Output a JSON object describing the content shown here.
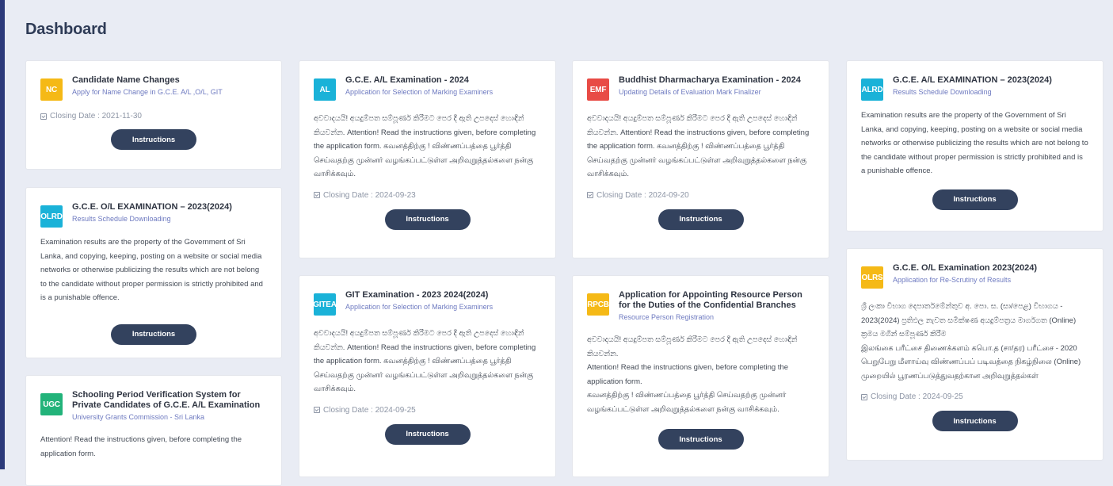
{
  "page": {
    "title": "Dashboard"
  },
  "button_label": "Instructions",
  "cards": {
    "nc": {
      "badge": "NC",
      "badge_color": "#f5b916",
      "title": "Candidate Name Changes",
      "subtitle": "Apply for Name Change in G.C.E. A/L ,O/L, GIT",
      "closing": "Closing Date : 2021-11-30"
    },
    "olrd": {
      "badge": "OLRD",
      "badge_color": "#1ab2d8",
      "title": "G.C.E. O/L EXAMINATION – 2023(2024)",
      "subtitle": "Results Schedule Downloading",
      "body": "Examination results are the property of the Government of Sri Lanka, and copying, keeping, posting on a website or social media networks or otherwise publicizing the results which are not belong to the candidate without proper permission is strictly prohibited and is a punishable offence."
    },
    "ugc": {
      "badge": "UGC",
      "badge_color": "#22b37a",
      "title": "Schooling Period Verification System for Private Candidates of G.C.E. A/L Examination",
      "subtitle": "University Grants Commission - Sri Lanka",
      "body": "Attention! Read the instructions given, before completing the application form."
    },
    "al": {
      "badge": "AL",
      "badge_color": "#1ab2d8",
      "title": "G.C.E. A/L Examination - 2024",
      "subtitle": "Application for Selection of Marking Examiners",
      "body": "අවවාදයයි! අයදුම්පත සම්පූර්ණ කිරීමට පෙර දී ඇති උපදෙස් හොඳින් කියවන්න. Attention! Read the instructions given, before completing the application form. கவனத்திற்கு ! விண்ணப்பத்தை பூர்த்தி செய்வதற்கு முன்னர் வழங்கப்பட்டுள்ள அறிவுறுத்தல்களை நன்கு வாசிக்கவும்.",
      "closing": "Closing Date : 2024-09-23"
    },
    "gitea": {
      "badge": "GITEA",
      "badge_color": "#1ab2d8",
      "title": "GIT Examination - 2023 2024(2024)",
      "subtitle": "Application for Selection of Marking Examiners",
      "body": "අවවාදයයි! අයදුම්පත සම්පූර්ණ කිරීමට පෙර දී ඇති උපදෙස් හොඳින් කියවන්න. Attention! Read the instructions given, before completing the application form. கவனத்திற்கு ! விண்ணப்பத்தை பூர்த்தி செய்வதற்கு முன்னர் வழங்கப்பட்டுள்ள அறிவுறுத்தல்களை நன்கு வாசிக்கவும்.",
      "closing": "Closing Date : 2024-09-25"
    },
    "emf": {
      "badge": "EMF",
      "badge_color": "#e84b45",
      "title": "Buddhist Dharmacharya Examination - 2024",
      "subtitle": "Updating Details of Evaluation Mark Finalizer",
      "body": "අවවාදයයි! අයදුම්පත සම්පූර්ණ කිරීමට පෙර දී ඇති උපදෙස් හොඳින් කියවන්න. Attention! Read the instructions given, before completing the application form. கவனத்திற்கு ! விண்ணப்பத்தை பூர்த்தி செய்வதற்கு முன்னர் வழங்கப்பட்டுள்ள அறிவுறுத்தல்களை நன்கு வாசிக்கவும்.",
      "closing": "Closing Date : 2024-09-20"
    },
    "rpcb": {
      "badge": "RPCB",
      "badge_color": "#f5b916",
      "title": "Application for Appointing Resource Person for the Duties of the Confidential Branches",
      "subtitle": "Resource Person Registration",
      "body_si": "අවවාදයයි! අයදුම්පත සම්පූර්ණ කිරීමට පෙර දී ඇති උපදෙස් හොඳින් කියවන්න.",
      "body_en": "Attention! Read the instructions given, before completing the application form.",
      "body_ta": "கவனத்திற்கு ! விண்ணப்பத்தை பூர்த்தி செய்வதற்கு முன்னர் வழங்கப்பட்டுள்ள அறிவுறுத்தல்களை நன்கு வாசிக்கவும்."
    },
    "alrd": {
      "badge": "ALRD",
      "badge_color": "#1ab2d8",
      "title": "G.C.E. A/L EXAMINATION – 2023(2024)",
      "subtitle": "Results Schedule Downloading",
      "body": "Examination results are the property of the Government of Sri Lanka, and copying, keeping, posting on a website or social media networks or otherwise publicizing the results which are not belong to the candidate without proper permission is strictly prohibited and is a punishable offence."
    },
    "olrs": {
      "badge": "OLRS",
      "badge_color": "#f5b916",
      "title": "G.C.E. O/L Examination 2023(2024)",
      "subtitle": "Application for Re-Scrutiny of Results",
      "body_si": "ශ්‍රී ලංකා විභාග දෙපාර්තමේන්තුව අ. පො. ස. (සා/පෙළ) විභාගය - 2023(2024) ප්‍රතිඵල නැවත සමීක්ෂණ අයදුම්පත්‍රය මාර්ගගත (Online) ක්‍රමය මගින් සම්පූර්ණ කිරීම",
      "body_ta": "இலங்கை பரீட்சை திணைக்களம் கபொ.த (சா/தர) பரீட்சை - 2020 பெறுபேறு மீளாய்வு விண்ணப்பப் படிவத்தை நிகழ்நிலை (Online) முறையில் பூரணப்படுத்துவதற்கான அறிவுறுத்தல்கள்",
      "closing": "Closing Date : 2024-09-25"
    }
  }
}
